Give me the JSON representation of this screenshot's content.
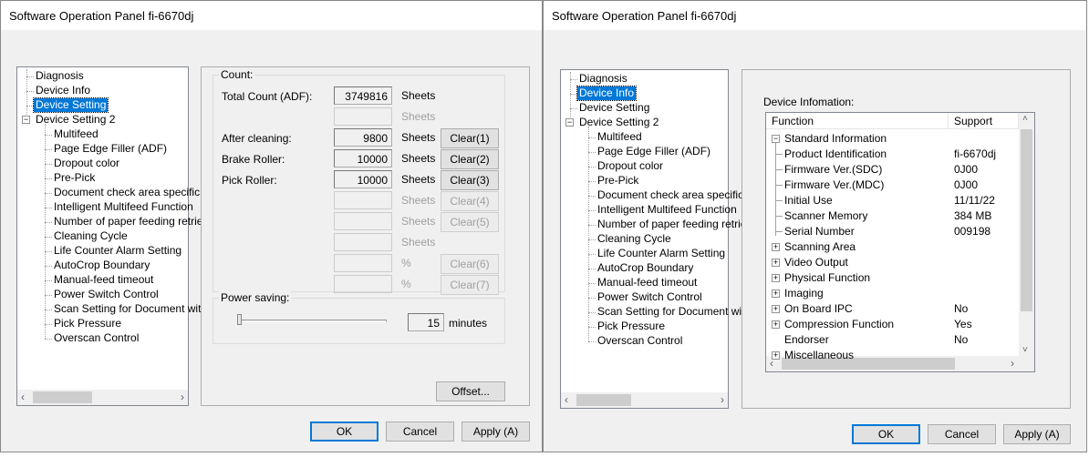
{
  "left": {
    "title": "Software Operation Panel fi-6670dj",
    "tree": [
      {
        "label": "Diagnosis",
        "level": 0
      },
      {
        "label": "Device Info",
        "level": 0
      },
      {
        "label": "Device Setting",
        "level": 0,
        "selected": true
      },
      {
        "label": "Device Setting 2",
        "level": 0,
        "expander": "−"
      },
      {
        "label": "Multifeed",
        "level": 1
      },
      {
        "label": "Page Edge Filler (ADF)",
        "level": 1
      },
      {
        "label": "Dropout color",
        "level": 1
      },
      {
        "label": "Pre-Pick",
        "level": 1
      },
      {
        "label": "Document check area specific",
        "level": 1
      },
      {
        "label": "Intelligent Multifeed Function",
        "level": 1
      },
      {
        "label": "Number of paper feeding retrie",
        "level": 1
      },
      {
        "label": "Cleaning Cycle",
        "level": 1
      },
      {
        "label": "Life Counter Alarm Setting",
        "level": 1
      },
      {
        "label": "AutoCrop Boundary",
        "level": 1
      },
      {
        "label": "Manual-feed timeout",
        "level": 1
      },
      {
        "label": "Power Switch Control",
        "level": 1
      },
      {
        "label": "Scan Setting for Document wit",
        "level": 1
      },
      {
        "label": "Pick Pressure",
        "level": 1
      },
      {
        "label": "Overscan Control",
        "level": 1
      }
    ],
    "count": {
      "legend": "Count:",
      "rows": [
        {
          "label": "Total Count (ADF):",
          "value": "3749816",
          "unit": "Sheets",
          "enabled": true
        },
        {
          "label": "",
          "value": "",
          "unit": "Sheets",
          "enabled": false
        },
        {
          "label": "After cleaning:",
          "value": "9800",
          "unit": "Sheets",
          "enabled": true,
          "clear": "Clear(1)"
        },
        {
          "label": "Brake Roller:",
          "value": "10000",
          "unit": "Sheets",
          "enabled": true,
          "clear": "Clear(2)"
        },
        {
          "label": "Pick Roller:",
          "value": "10000",
          "unit": "Sheets",
          "enabled": true,
          "clear": "Clear(3)"
        },
        {
          "label": "",
          "value": "",
          "unit": "Sheets",
          "enabled": false,
          "clear": "Clear(4)"
        },
        {
          "label": "",
          "value": "",
          "unit": "Sheets",
          "enabled": false,
          "clear": "Clear(5)"
        },
        {
          "label": "",
          "value": "",
          "unit": "Sheets",
          "enabled": false
        },
        {
          "label": "",
          "value": "",
          "unit": "%",
          "enabled": false,
          "clear": "Clear(6)"
        },
        {
          "label": "",
          "value": "",
          "unit": "%",
          "enabled": false,
          "clear": "Clear(7)"
        }
      ]
    },
    "power": {
      "legend": "Power saving:",
      "value": "15",
      "unit": "minutes",
      "slider_fraction": 0
    },
    "offset": "Offset...",
    "ok": "OK",
    "cancel": "Cancel",
    "apply": "Apply (A)"
  },
  "right": {
    "title": "Software Operation Panel fi-6670dj",
    "tree": [
      {
        "label": "Diagnosis",
        "level": 0
      },
      {
        "label": "Device Info",
        "level": 0,
        "selected": true
      },
      {
        "label": "Device Setting",
        "level": 0
      },
      {
        "label": "Device Setting 2",
        "level": 0,
        "expander": "−"
      },
      {
        "label": "Multifeed",
        "level": 1
      },
      {
        "label": "Page Edge Filler (ADF)",
        "level": 1
      },
      {
        "label": "Dropout color",
        "level": 1
      },
      {
        "label": "Pre-Pick",
        "level": 1
      },
      {
        "label": "Document check area specific",
        "level": 1
      },
      {
        "label": "Intelligent Multifeed Function",
        "level": 1
      },
      {
        "label": "Number of paper feeding retrie",
        "level": 1
      },
      {
        "label": "Cleaning Cycle",
        "level": 1
      },
      {
        "label": "Life Counter Alarm Setting",
        "level": 1
      },
      {
        "label": "AutoCrop Boundary",
        "level": 1
      },
      {
        "label": "Manual-feed timeout",
        "level": 1
      },
      {
        "label": "Power Switch Control",
        "level": 1
      },
      {
        "label": "Scan Setting for Document wit",
        "level": 1
      },
      {
        "label": "Pick Pressure",
        "level": 1
      },
      {
        "label": "Overscan Control",
        "level": 1
      }
    ],
    "info_label": "Device Infomation:",
    "columns": [
      "Function",
      "Support"
    ],
    "rows": [
      {
        "name": "Standard Information",
        "value": "",
        "expander": "−",
        "level": 0
      },
      {
        "name": "Product Identification",
        "value": "fi-6670dj",
        "level": 1
      },
      {
        "name": "Firmware Ver.(SDC)",
        "value": "0J00",
        "level": 1
      },
      {
        "name": "Firmware Ver.(MDC)",
        "value": "0J00",
        "level": 1
      },
      {
        "name": "Initial Use",
        "value": "11/11/22",
        "level": 1
      },
      {
        "name": "Scanner Memory",
        "value": "384 MB",
        "level": 1
      },
      {
        "name": "Serial Number",
        "value": "009198",
        "level": 1
      },
      {
        "name": "Scanning Area",
        "value": "",
        "expander": "+",
        "level": 0
      },
      {
        "name": "Video Output",
        "value": "",
        "expander": "+",
        "level": 0
      },
      {
        "name": "Physical Function",
        "value": "",
        "expander": "+",
        "level": 0
      },
      {
        "name": "Imaging",
        "value": "",
        "expander": "+",
        "level": 0
      },
      {
        "name": "On Board IPC",
        "value": "No",
        "expander": "+",
        "level": 0
      },
      {
        "name": "Compression Function",
        "value": "Yes",
        "expander": "+",
        "level": 0
      },
      {
        "name": "Endorser",
        "value": "No",
        "level": 0
      },
      {
        "name": "Miscellaneous",
        "value": "",
        "expander": "+",
        "level": 0
      }
    ],
    "ok": "OK",
    "cancel": "Cancel",
    "apply": "Apply (A)"
  }
}
